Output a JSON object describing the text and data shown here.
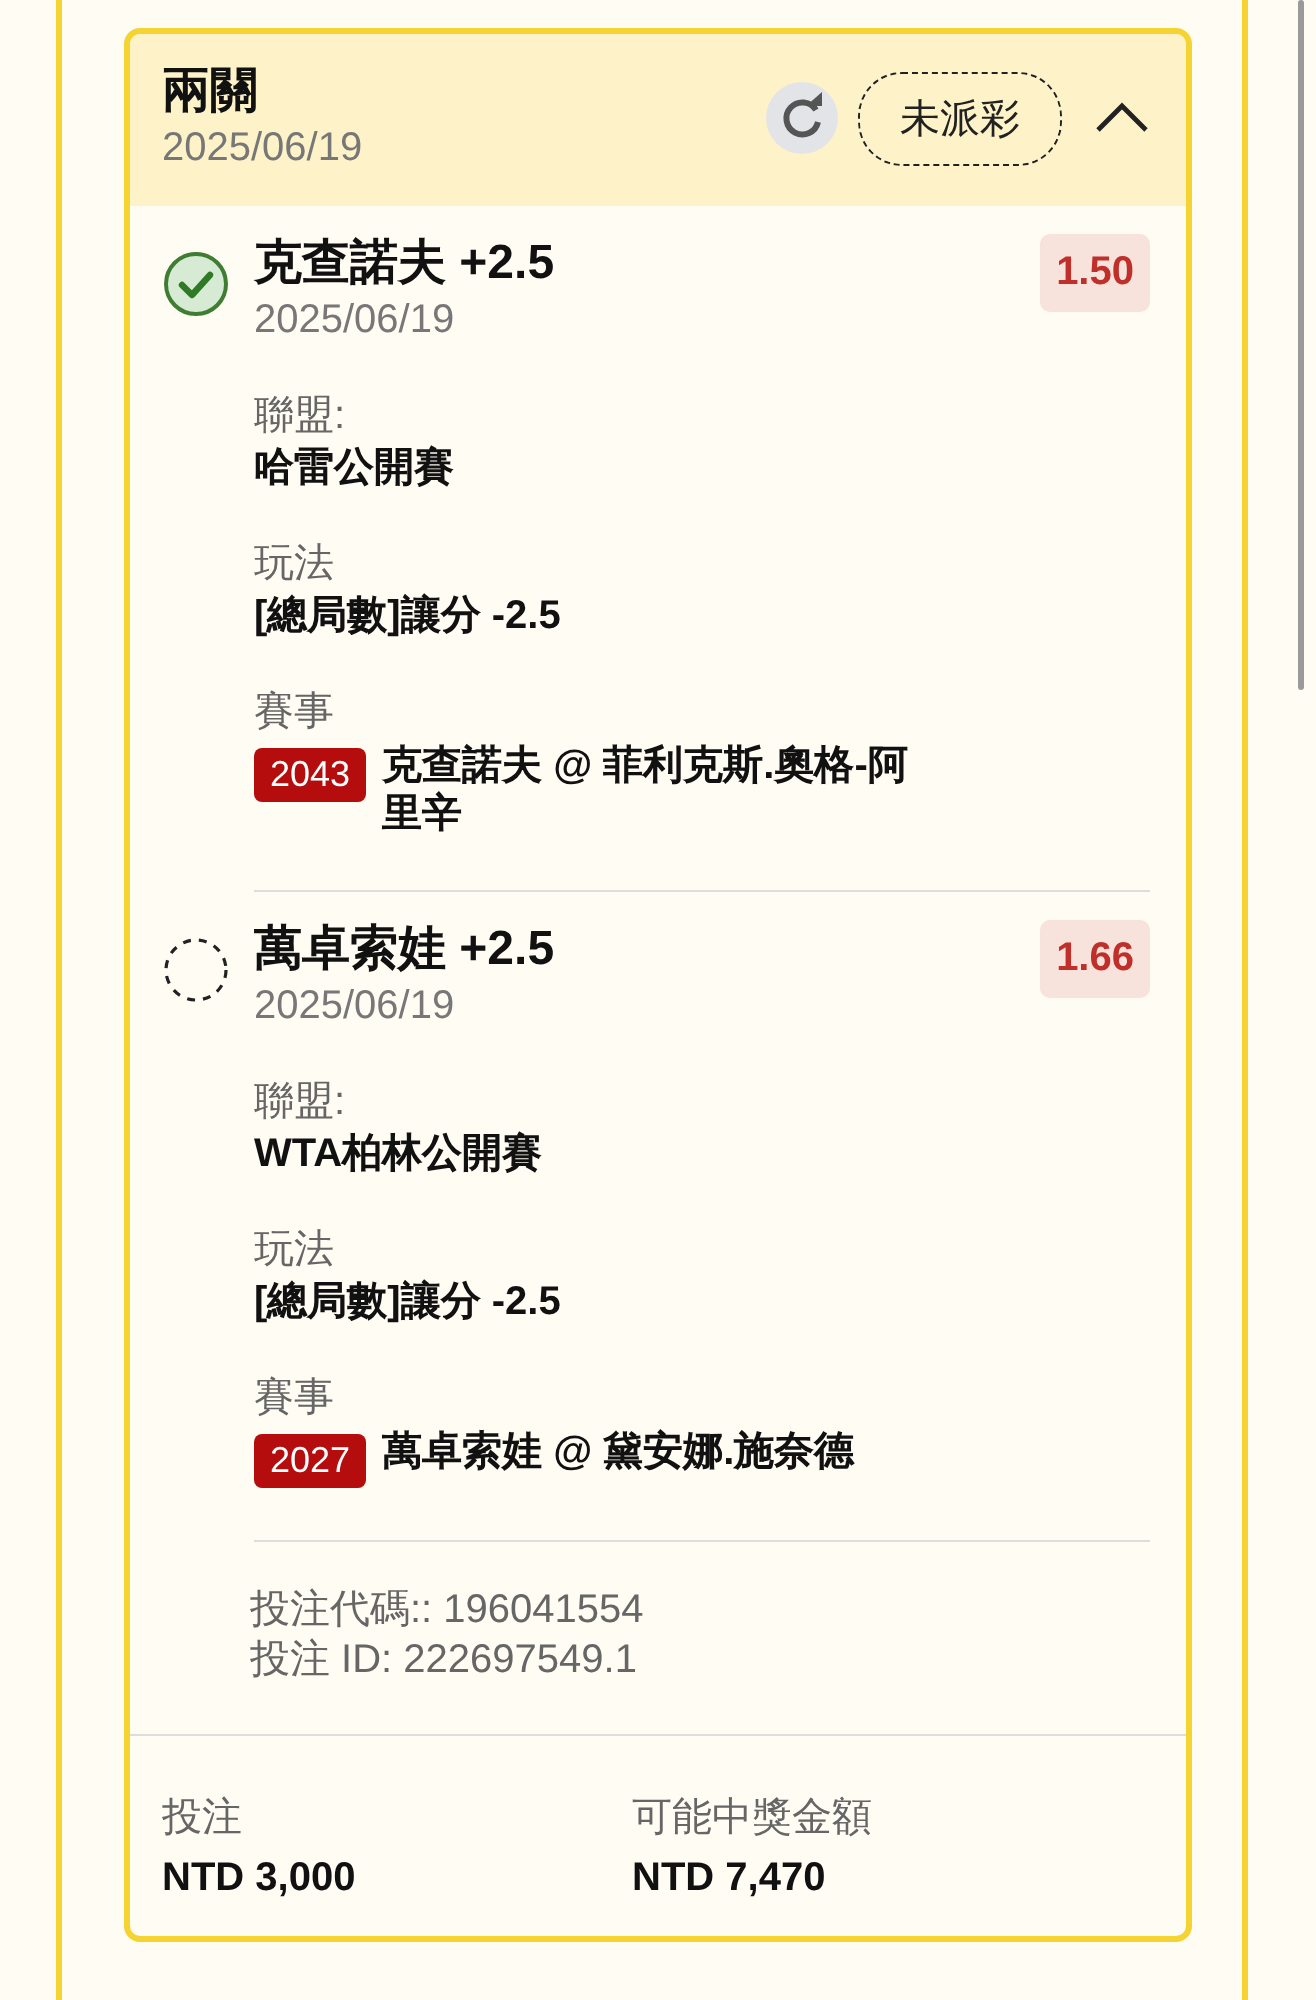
{
  "header": {
    "title": "兩關",
    "date": "2025/06/19",
    "status_badge": "未派彩",
    "expanded": true
  },
  "legs": [
    {
      "kind": "won",
      "selection": "克查諾夫 +2.5",
      "date": "2025/06/19",
      "odds": "1.50",
      "league_label": "聯盟:",
      "league": "哈雷公開賽",
      "market_label": "玩法",
      "market": "[總局數]讓分 -2.5",
      "event_label": "賽事",
      "match_no": "2043",
      "match": "克查諾夫 @ 菲利克斯.奧格-阿里辛"
    },
    {
      "kind": "pending",
      "selection": "萬卓索娃 +2.5",
      "date": "2025/06/19",
      "odds": "1.66",
      "league_label": "聯盟:",
      "league": "WTA柏林公開賽",
      "market_label": "玩法",
      "market": "[總局數]讓分 -2.5",
      "event_label": "賽事",
      "match_no": "2027",
      "match": "萬卓索娃 @ 黛安娜.施奈德"
    }
  ],
  "bet_code": "投注代碼:: 196041554",
  "bet_id": "投注 ID: 222697549.1",
  "footer": {
    "stake_label": "投注",
    "stake": "NTD 3,000",
    "payout_label": "可能中獎金額",
    "payout": "NTD 7,470"
  }
}
